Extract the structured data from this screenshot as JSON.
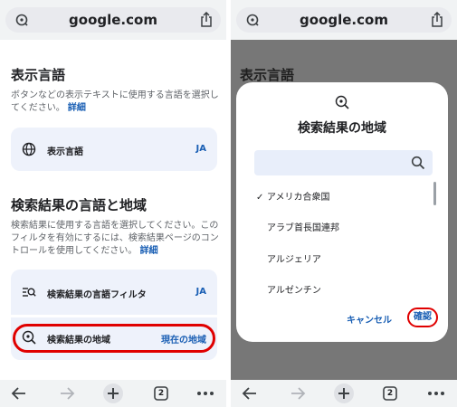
{
  "browser": {
    "url": "google.com",
    "tab_count": "2"
  },
  "left": {
    "display_language": {
      "heading": "表示言語",
      "description": "ボタンなどの表示テキストに使用する言語を選択してください。",
      "link": "詳細",
      "row_label": "表示言語",
      "row_value": "JA"
    },
    "search_settings": {
      "heading": "検索結果の言語と地域",
      "description": "検索結果に使用する言語を選択してください。このフィルタを有効にするには、検索結果ページのコントロールを使用してください。",
      "link": "詳細",
      "language_filter_label": "検索結果の言語フィルタ",
      "language_filter_value": "JA",
      "region_label": "検索結果の地域",
      "region_value": "現在の地域"
    }
  },
  "right": {
    "dimmed_heading": "表示言語",
    "dialog": {
      "title": "検索結果の地域",
      "search_value": "",
      "search_placeholder": "",
      "options": [
        {
          "label": "アメリカ合衆国",
          "selected": true
        },
        {
          "label": "アラブ首長国連邦",
          "selected": false
        },
        {
          "label": "アルジェリア",
          "selected": false
        },
        {
          "label": "アルゼンチン",
          "selected": false
        }
      ],
      "cancel_label": "キャンセル",
      "confirm_label": "確認"
    }
  },
  "colors": {
    "accent": "#1a5fb4",
    "card_bg": "#eef2fb",
    "highlight": "#e00000",
    "scrim": "#777777"
  },
  "icons": {
    "site": "site-settings-icon",
    "share": "share-icon",
    "globe": "globe-icon",
    "filter": "language-filter-icon",
    "region": "region-search-icon",
    "search": "search-icon",
    "back": "back-arrow-icon",
    "forward": "forward-arrow-icon",
    "new_tab": "plus-icon",
    "tabs": "tabs-icon",
    "more": "more-icon"
  }
}
